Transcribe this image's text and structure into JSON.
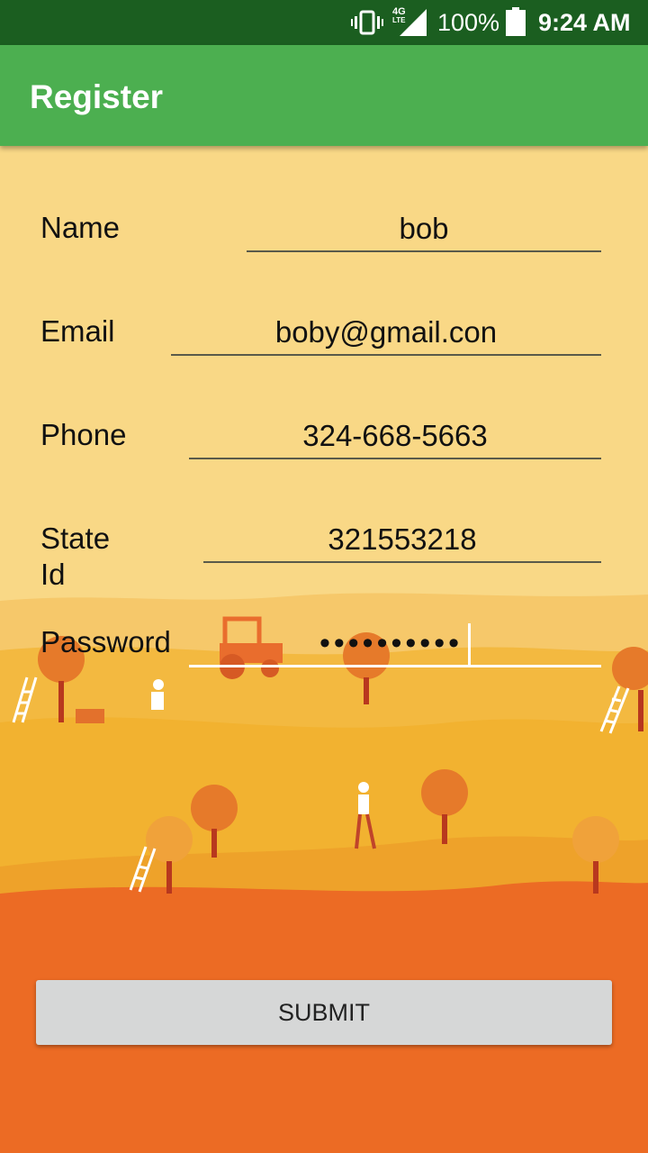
{
  "status_bar": {
    "network": "4G",
    "network_sub": "LTE",
    "battery_percent": "100%",
    "time": "9:24 AM"
  },
  "app_bar": {
    "title": "Register"
  },
  "form": {
    "name": {
      "label": "Name",
      "value": "bob"
    },
    "email": {
      "label": "Email",
      "value": "boby@gmail.con"
    },
    "phone": {
      "label": "Phone",
      "value": "324-668-5663"
    },
    "state_id": {
      "label": "State Id",
      "value": "321553218"
    },
    "password": {
      "label": "Password",
      "value": "••••••••••"
    }
  },
  "submit_label": "SUBMIT",
  "colors": {
    "status_bar": "#1b5e20",
    "app_bar": "#4caf50",
    "background_top": "#f9d886",
    "background_bottom": "#ec6b24"
  }
}
